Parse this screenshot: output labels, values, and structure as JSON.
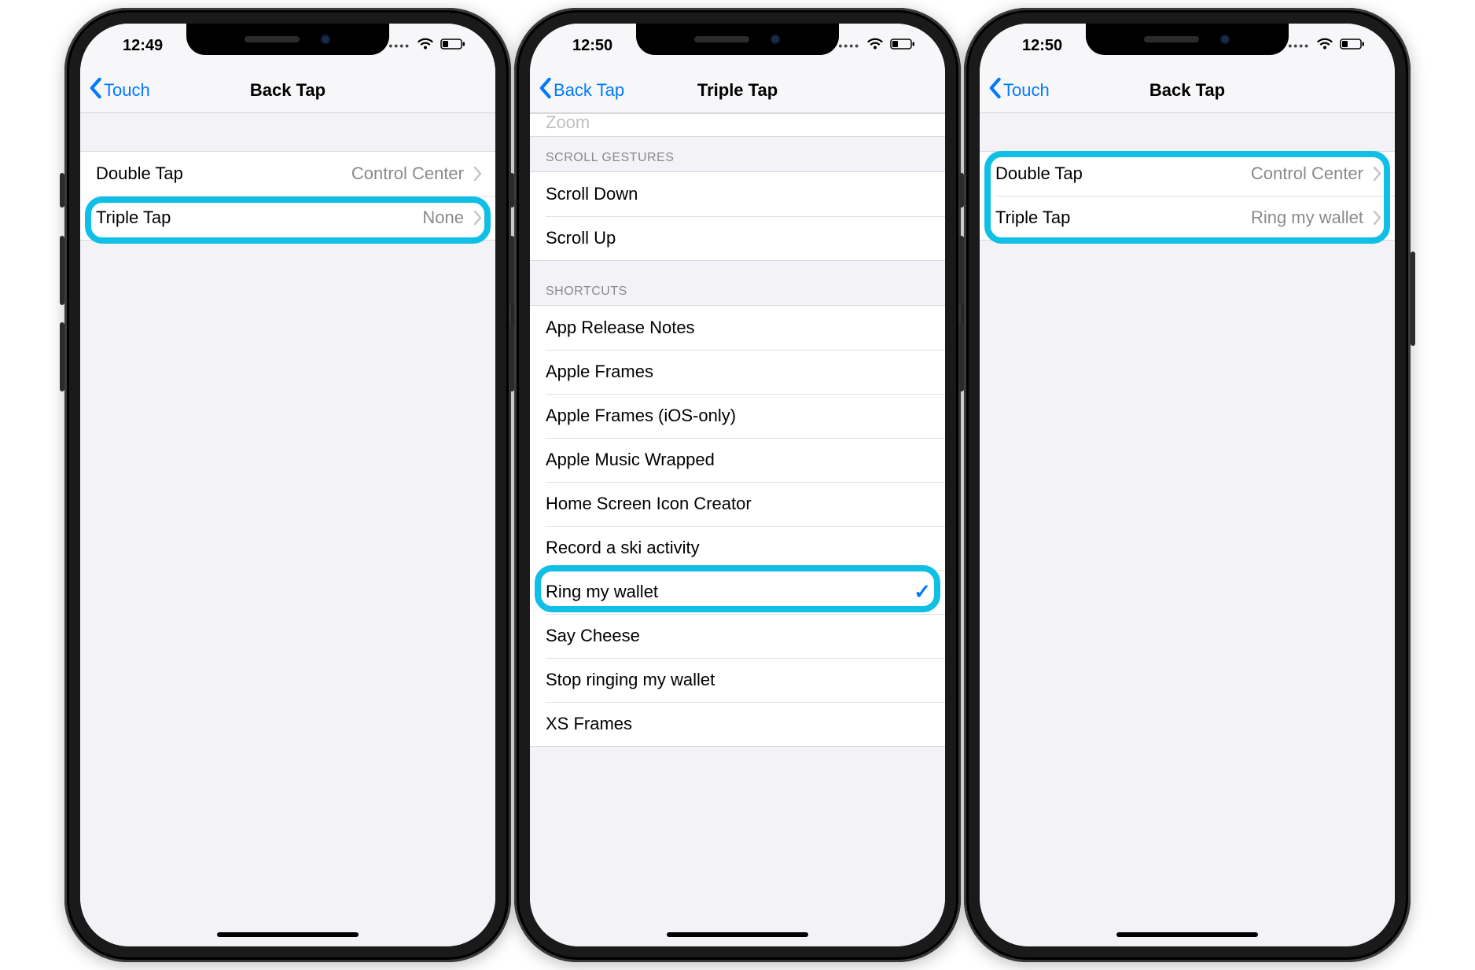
{
  "phones": [
    {
      "status": {
        "time": "12:49"
      },
      "nav": {
        "back": "Touch",
        "title": "Back Tap"
      },
      "rows": [
        {
          "label": "Double Tap",
          "value": "Control Center"
        },
        {
          "label": "Triple Tap",
          "value": "None"
        }
      ]
    },
    {
      "status": {
        "time": "12:50"
      },
      "nav": {
        "back": "Back Tap",
        "title": "Triple Tap"
      },
      "partial_row": "Zoom",
      "section1": {
        "header": "SCROLL GESTURES",
        "items": [
          "Scroll Down",
          "Scroll Up"
        ]
      },
      "section2": {
        "header": "SHORTCUTS",
        "items": [
          "App Release Notes",
          "Apple Frames",
          "Apple Frames (iOS-only)",
          "Apple Music Wrapped",
          "Home Screen Icon Creator",
          "Record a ski activity",
          "Ring my wallet",
          "Say Cheese",
          "Stop ringing my wallet",
          "XS Frames"
        ],
        "selected": "Ring my wallet"
      }
    },
    {
      "status": {
        "time": "12:50"
      },
      "nav": {
        "back": "Touch",
        "title": "Back Tap"
      },
      "rows": [
        {
          "label": "Double Tap",
          "value": "Control Center"
        },
        {
          "label": "Triple Tap",
          "value": "Ring my wallet"
        }
      ]
    }
  ]
}
